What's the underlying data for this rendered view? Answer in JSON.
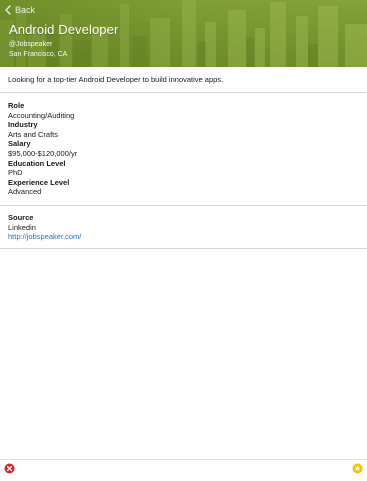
{
  "nav": {
    "back_label": "Back"
  },
  "job": {
    "title": "Android Developer",
    "handle": "@Jobspeaker",
    "location": "San Francisco, CA",
    "summary": "Looking for a top-tier Android Developer to build innovative apps."
  },
  "details": [
    {
      "label": "Role",
      "value": "Accounting/Auditing"
    },
    {
      "label": "Industry",
      "value": "Arts and Crafts"
    },
    {
      "label": "Salary",
      "value": "$95,000-$120,000/yr"
    },
    {
      "label": "Education Level",
      "value": "PhD"
    },
    {
      "label": "Experience Level",
      "value": "Advanced"
    }
  ],
  "source": {
    "label": "Source",
    "name": "Linkedin",
    "url": "http://jobspeaker.com/"
  },
  "icons": {
    "back": "chevron-left-icon",
    "reject": "close-circle-icon",
    "favorite": "star-circle-icon"
  },
  "colors": {
    "header_green": "#7a9a32",
    "link_blue": "#2a6fd6",
    "reject_red": "#d0262c",
    "star_yellow": "#f2c400"
  }
}
